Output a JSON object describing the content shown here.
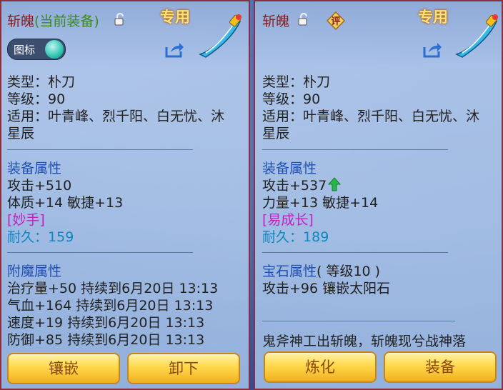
{
  "left": {
    "name": "斩魄",
    "name_suffix": "(当前装备)",
    "tag": "专用",
    "icon_toggle_label": "图标",
    "type_line": "类型：朴刀",
    "level_line": "等级：90",
    "suits_line1": "适用：叶青峰、烈千阳、白无忧、沐",
    "suits_line2": "星辰",
    "equip_attr_title": "装备属性",
    "attack": "攻击+510",
    "stats": "体质+14 敏捷+13",
    "special": "[妙手]",
    "durability_label": "耐久：",
    "durability_value": "159",
    "enchant_title": "附魔属性",
    "enchants": [
      "治疗量+50 持续到6月20日 13:13",
      "气血+164 持续到6月20日 13:13",
      "速度+19 持续到6月20日 13:13",
      "防御+85 持续到6月20日 13:13"
    ],
    "button1": "镶嵌",
    "button2": "卸下"
  },
  "right": {
    "name": "斩魄",
    "eval_badge": "评",
    "tag": "专用",
    "type_line": "类型：朴刀",
    "level_line": "等级：90",
    "suits_line1": "适用：叶青峰、烈千阳、白无忧、沐",
    "suits_line2": "星辰",
    "equip_attr_title": "装备属性",
    "attack": "攻击+537",
    "stats": "力量+13 敏捷+14",
    "special": "[易成长]",
    "durability_label": "耐久：",
    "durability_value": "189",
    "gem_title": "宝石属性",
    "gem_level": "( 等级10 )",
    "gem_line": "攻击+96 镶嵌太阳石",
    "flavor": "鬼斧神工出斩魄，斩魄现兮战神落",
    "button1": "炼化",
    "button2": "装备"
  },
  "colors": {
    "title_red": "#8b1a1a",
    "suffix_green": "#3a8a1a",
    "section_blue": "#1f4fb0",
    "special_purple": "#c020c0",
    "durability_cyan": "#0a8ac0",
    "tag_gold": "#ffe27a",
    "button_gold": "#ffd84a"
  },
  "icons": [
    "lock-open-icon",
    "share-icon",
    "weapon-icon",
    "up-arrow-icon",
    "eval-badge-icon"
  ]
}
